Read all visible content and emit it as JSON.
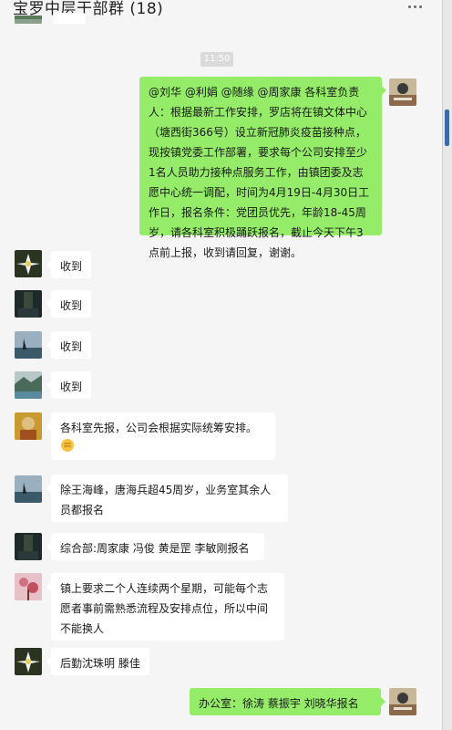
{
  "header": {
    "title": "宝罗中层干部群 (18)"
  },
  "time_divider": "11:50",
  "messages": [
    {
      "sender": "self",
      "text": "@刘华 @利娟 @随缘 @周家康 各科室负责人：根据最新工作安排，罗店将在镇文体中心（塘西街366号）设立新冠肺炎疫苗接种点，现按镇党委工作部署，要求每个公司安排至少1名人员助力接种点服务工作，由镇团委及志愿中心统一调配，时间为4月19日-4月30日工作日，报名条件：党团员优先，年龄18-45周岁，请各科室积极踊跃报名，截止今天下午3点前上报，收到请回复，谢谢。"
    },
    {
      "sender": "member1",
      "text": "收到"
    },
    {
      "sender": "member2",
      "text": "收到"
    },
    {
      "sender": "member3",
      "text": "收到"
    },
    {
      "sender": "member4",
      "text": "收到"
    },
    {
      "sender": "member5",
      "text": "各科室先报，公司会根据实际统筹安排。",
      "emoji": "fist-icon"
    },
    {
      "sender": "member3",
      "text": "除王海峰，唐海兵超45周岁，业务室其余人员都报名"
    },
    {
      "sender": "member2",
      "text": "综合部:周家康 冯俊 黄是罡 李敏刚报名"
    },
    {
      "sender": "member6",
      "text": "镇上要求二个人连续两个星期，可能每个志愿者事前需熟悉流程及安排点位，所以中间不能换人"
    },
    {
      "sender": "member1",
      "text": "后勤沈珠明 滕佳"
    },
    {
      "sender": "self",
      "text": "办公室：徐涛 蔡振宇 刘晓华报名"
    }
  ],
  "colors": {
    "self_bubble": "#95ec69",
    "other_bubble": "#ffffff",
    "background": "#f5f5f5"
  }
}
